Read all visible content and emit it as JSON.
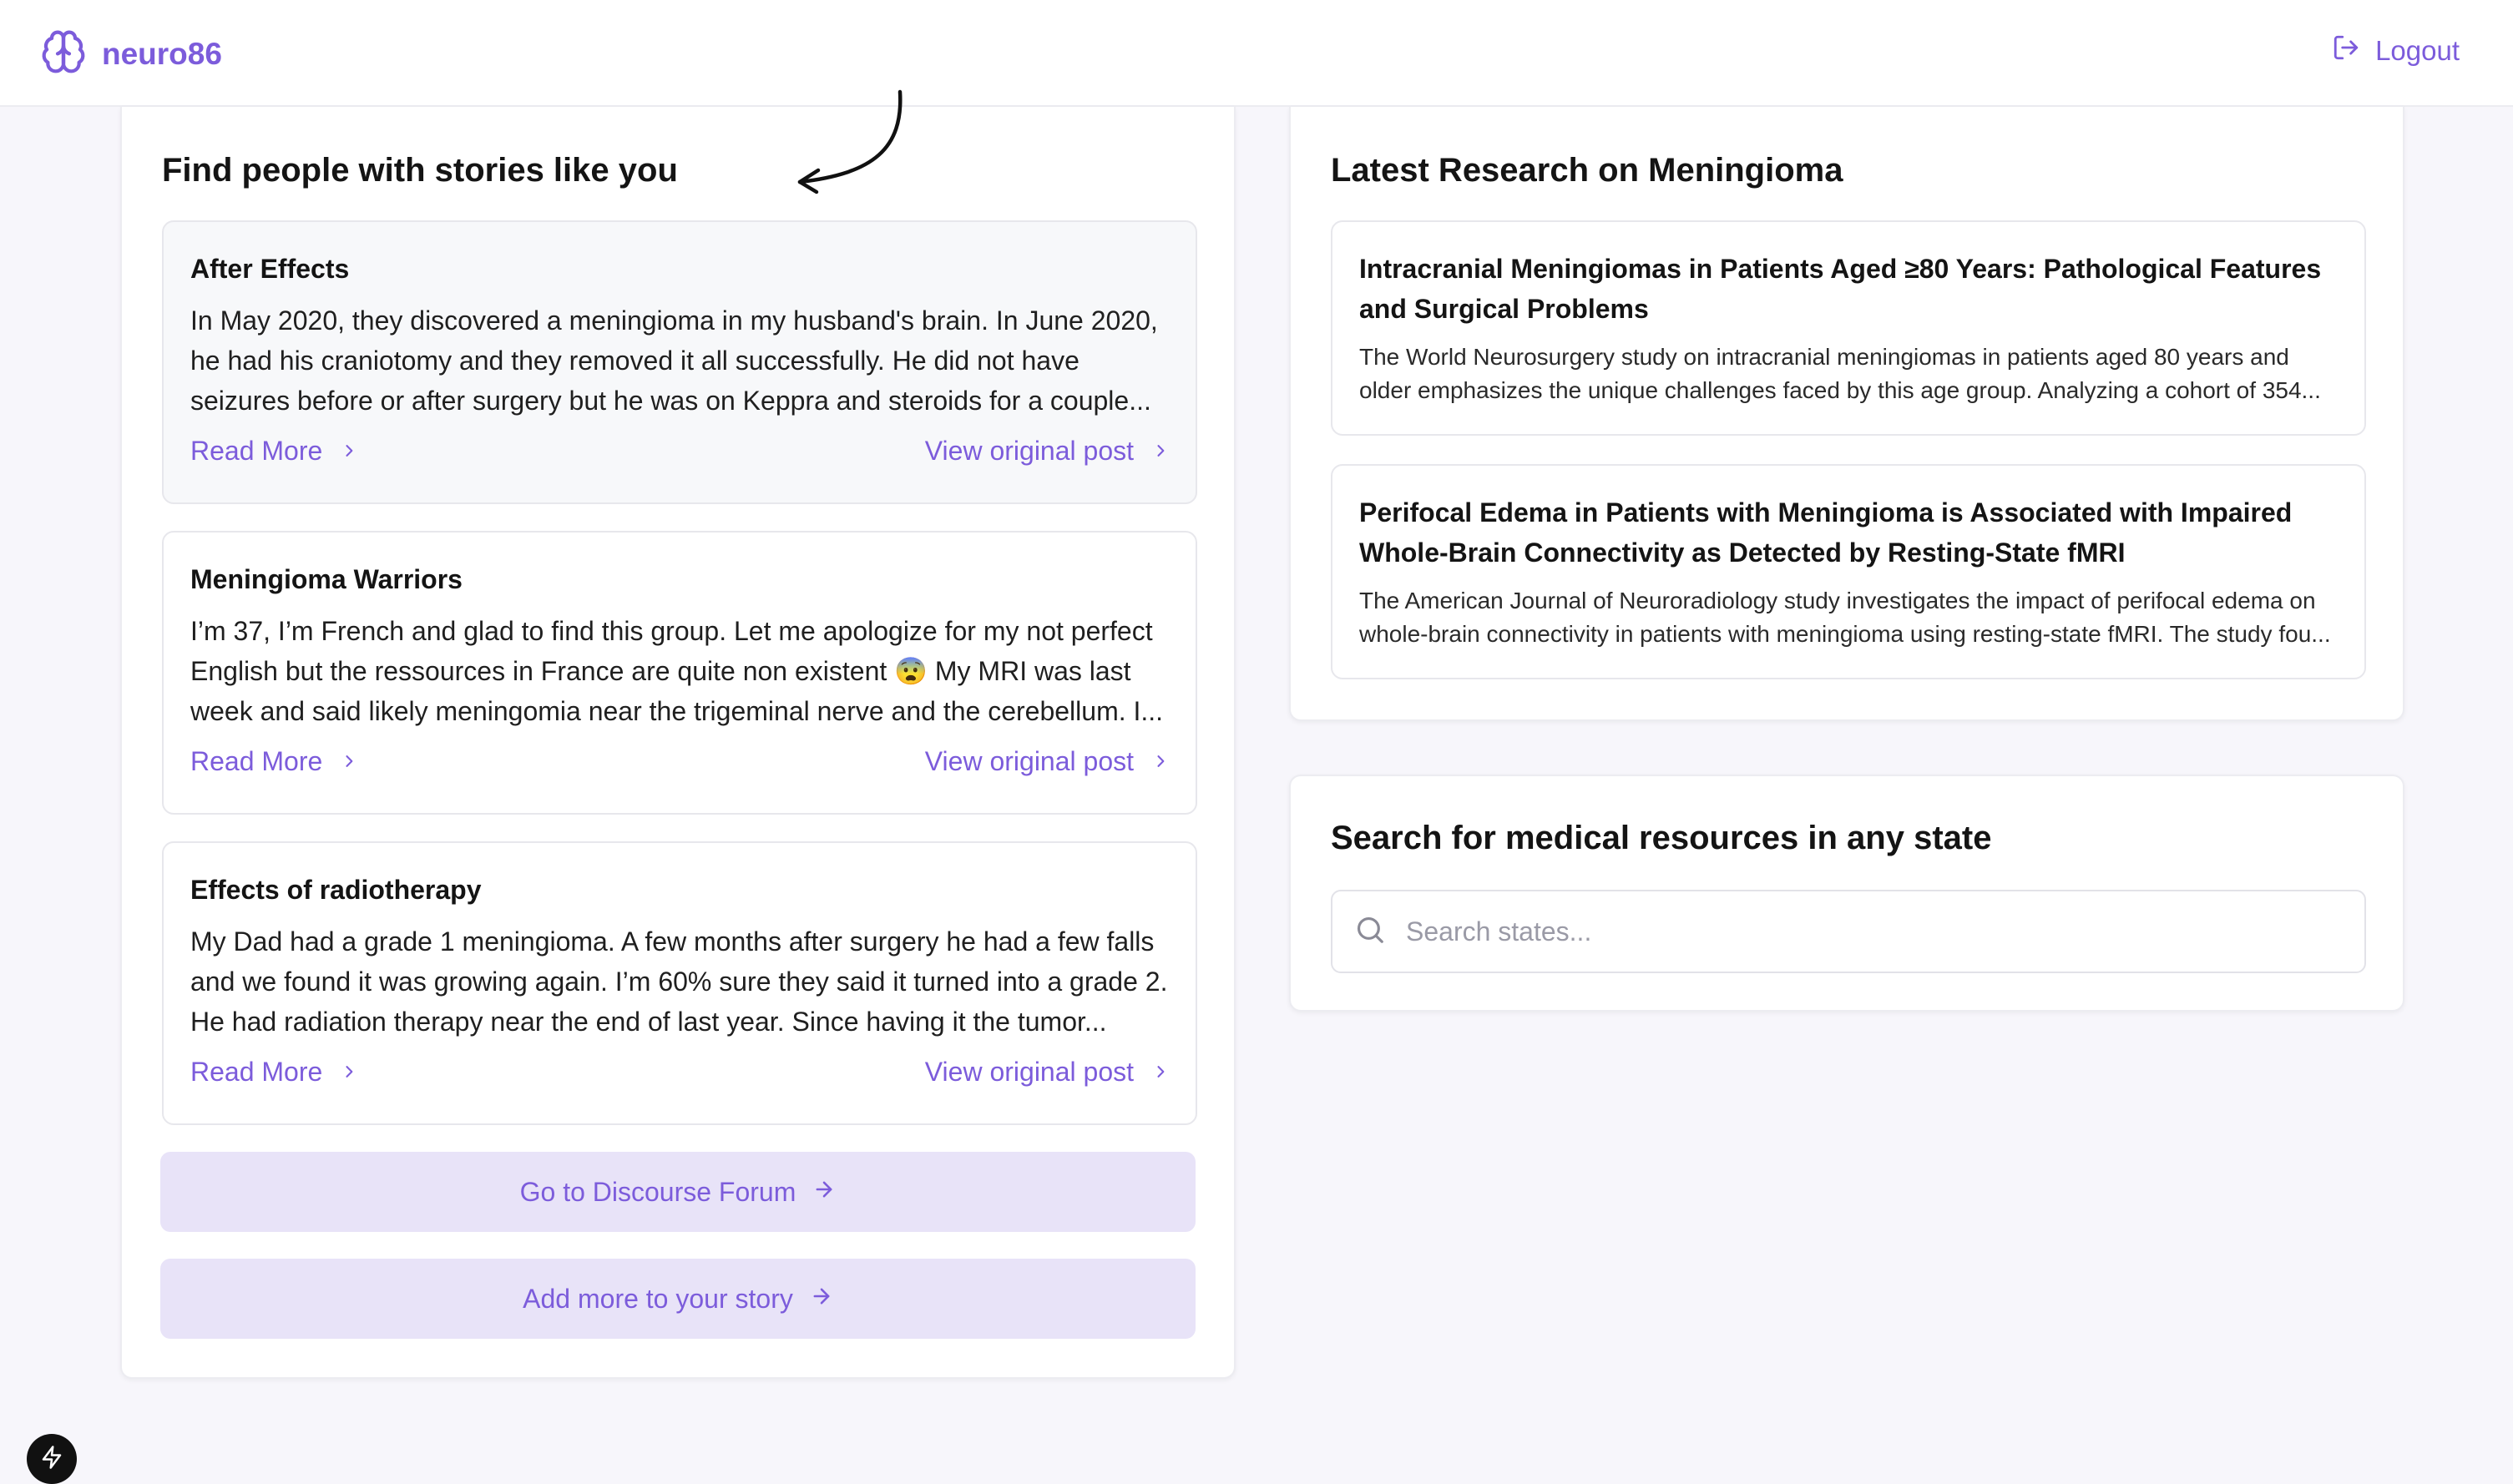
{
  "app": {
    "name": "neuro86",
    "logout_label": "Logout",
    "accent": "#7c5cdb"
  },
  "stories_section": {
    "title": "Find people with stories like you",
    "read_more": "Read More",
    "view_original": "View original post",
    "items": [
      {
        "title": "After Effects",
        "excerpt": "In May 2020, they discovered a meningioma in my husband's brain. In June 2020, he had his craniotomy and they removed it all successfully. He did not have seizures before or after surgery but he was on Keppra and steroids for a couple..."
      },
      {
        "title": "Meningioma Warriors",
        "excerpt": "I’m 37, I’m French and glad to find this group. Let me apologize for my not perfect English but the ressources in France are quite non existent 😨 My MRI was last week and said likely meningomia near the trigeminal nerve and the cerebellum. I..."
      },
      {
        "title": "Effects of radiotherapy",
        "excerpt": "My Dad had a grade 1 meningioma. A few months after surgery he had a few falls and we found it was growing again. I’m 60% sure they said it turned into a grade 2. He had radiation therapy near the end of last year. Since having it the tumor..."
      }
    ],
    "forum_button": "Go to Discourse Forum",
    "story_button": "Add more to your story"
  },
  "research_section": {
    "title": "Latest Research on Meningioma",
    "items": [
      {
        "title": "Intracranial Meningiomas in Patients Aged ≥80 Years: Pathological Features and Surgical Problems",
        "summary": "The World Neurosurgery study on intracranial meningiomas in patients aged 80 years and older emphasizes the unique challenges faced by this age group. Analyzing a cohort of 354..."
      },
      {
        "title": "Perifocal Edema in Patients with Meningioma is Associated with Impaired Whole-Brain Connectivity as Detected by Resting-State fMRI",
        "summary": "The American Journal of Neuroradiology study investigates the impact of perifocal edema on whole-brain connectivity in patients with meningioma using resting-state fMRI. The study fou..."
      }
    ]
  },
  "search_section": {
    "title": "Search for medical resources in any state",
    "placeholder": "Search states...",
    "value": ""
  }
}
